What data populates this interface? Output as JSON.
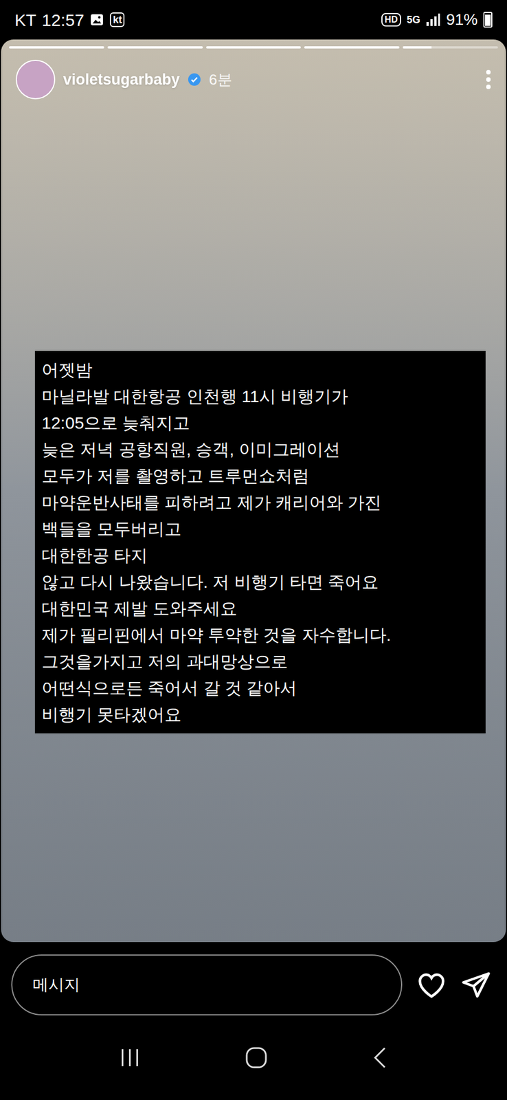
{
  "status_bar": {
    "carrier": "KT",
    "time": "12:57",
    "carrier_badge": "kt",
    "hd": "HD",
    "network": "5G",
    "battery": "91%",
    "battery_level": 0.91
  },
  "story": {
    "segments": [
      {
        "level": 1
      },
      {
        "level": 1
      },
      {
        "level": 1
      },
      {
        "level": 1
      },
      {
        "level": 0.3
      }
    ],
    "username": "violetsugarbaby",
    "verified": true,
    "age": "6분",
    "caption_lines": [
      "어젯밤",
      "마닐라발 대한항공 인천행 11시 비행기가",
      "12:05으로 늦춰지고",
      "늦은 저녁 공항직원, 승객, 이미그레이션",
      "모두가 저를 촬영하고 트루먼쇼처럼",
      "마약운반사태를 피하려고 제가 캐리어와 가진",
      "백들을 모두버리고",
      "대한한공 타지",
      "않고 다시 나왔습니다. 저 비행기 타면 죽어요",
      "대한민국 제발 도와주세요",
      "제가 필리핀에서 마약 투약한 것을 자수합니다.",
      "그것을가지고 저의 과대망상으로",
      "어떤식으로든 죽어서 갈 것 같아서",
      "비행기 못타겠어요"
    ]
  },
  "reply_bar": {
    "placeholder": "메시지"
  }
}
